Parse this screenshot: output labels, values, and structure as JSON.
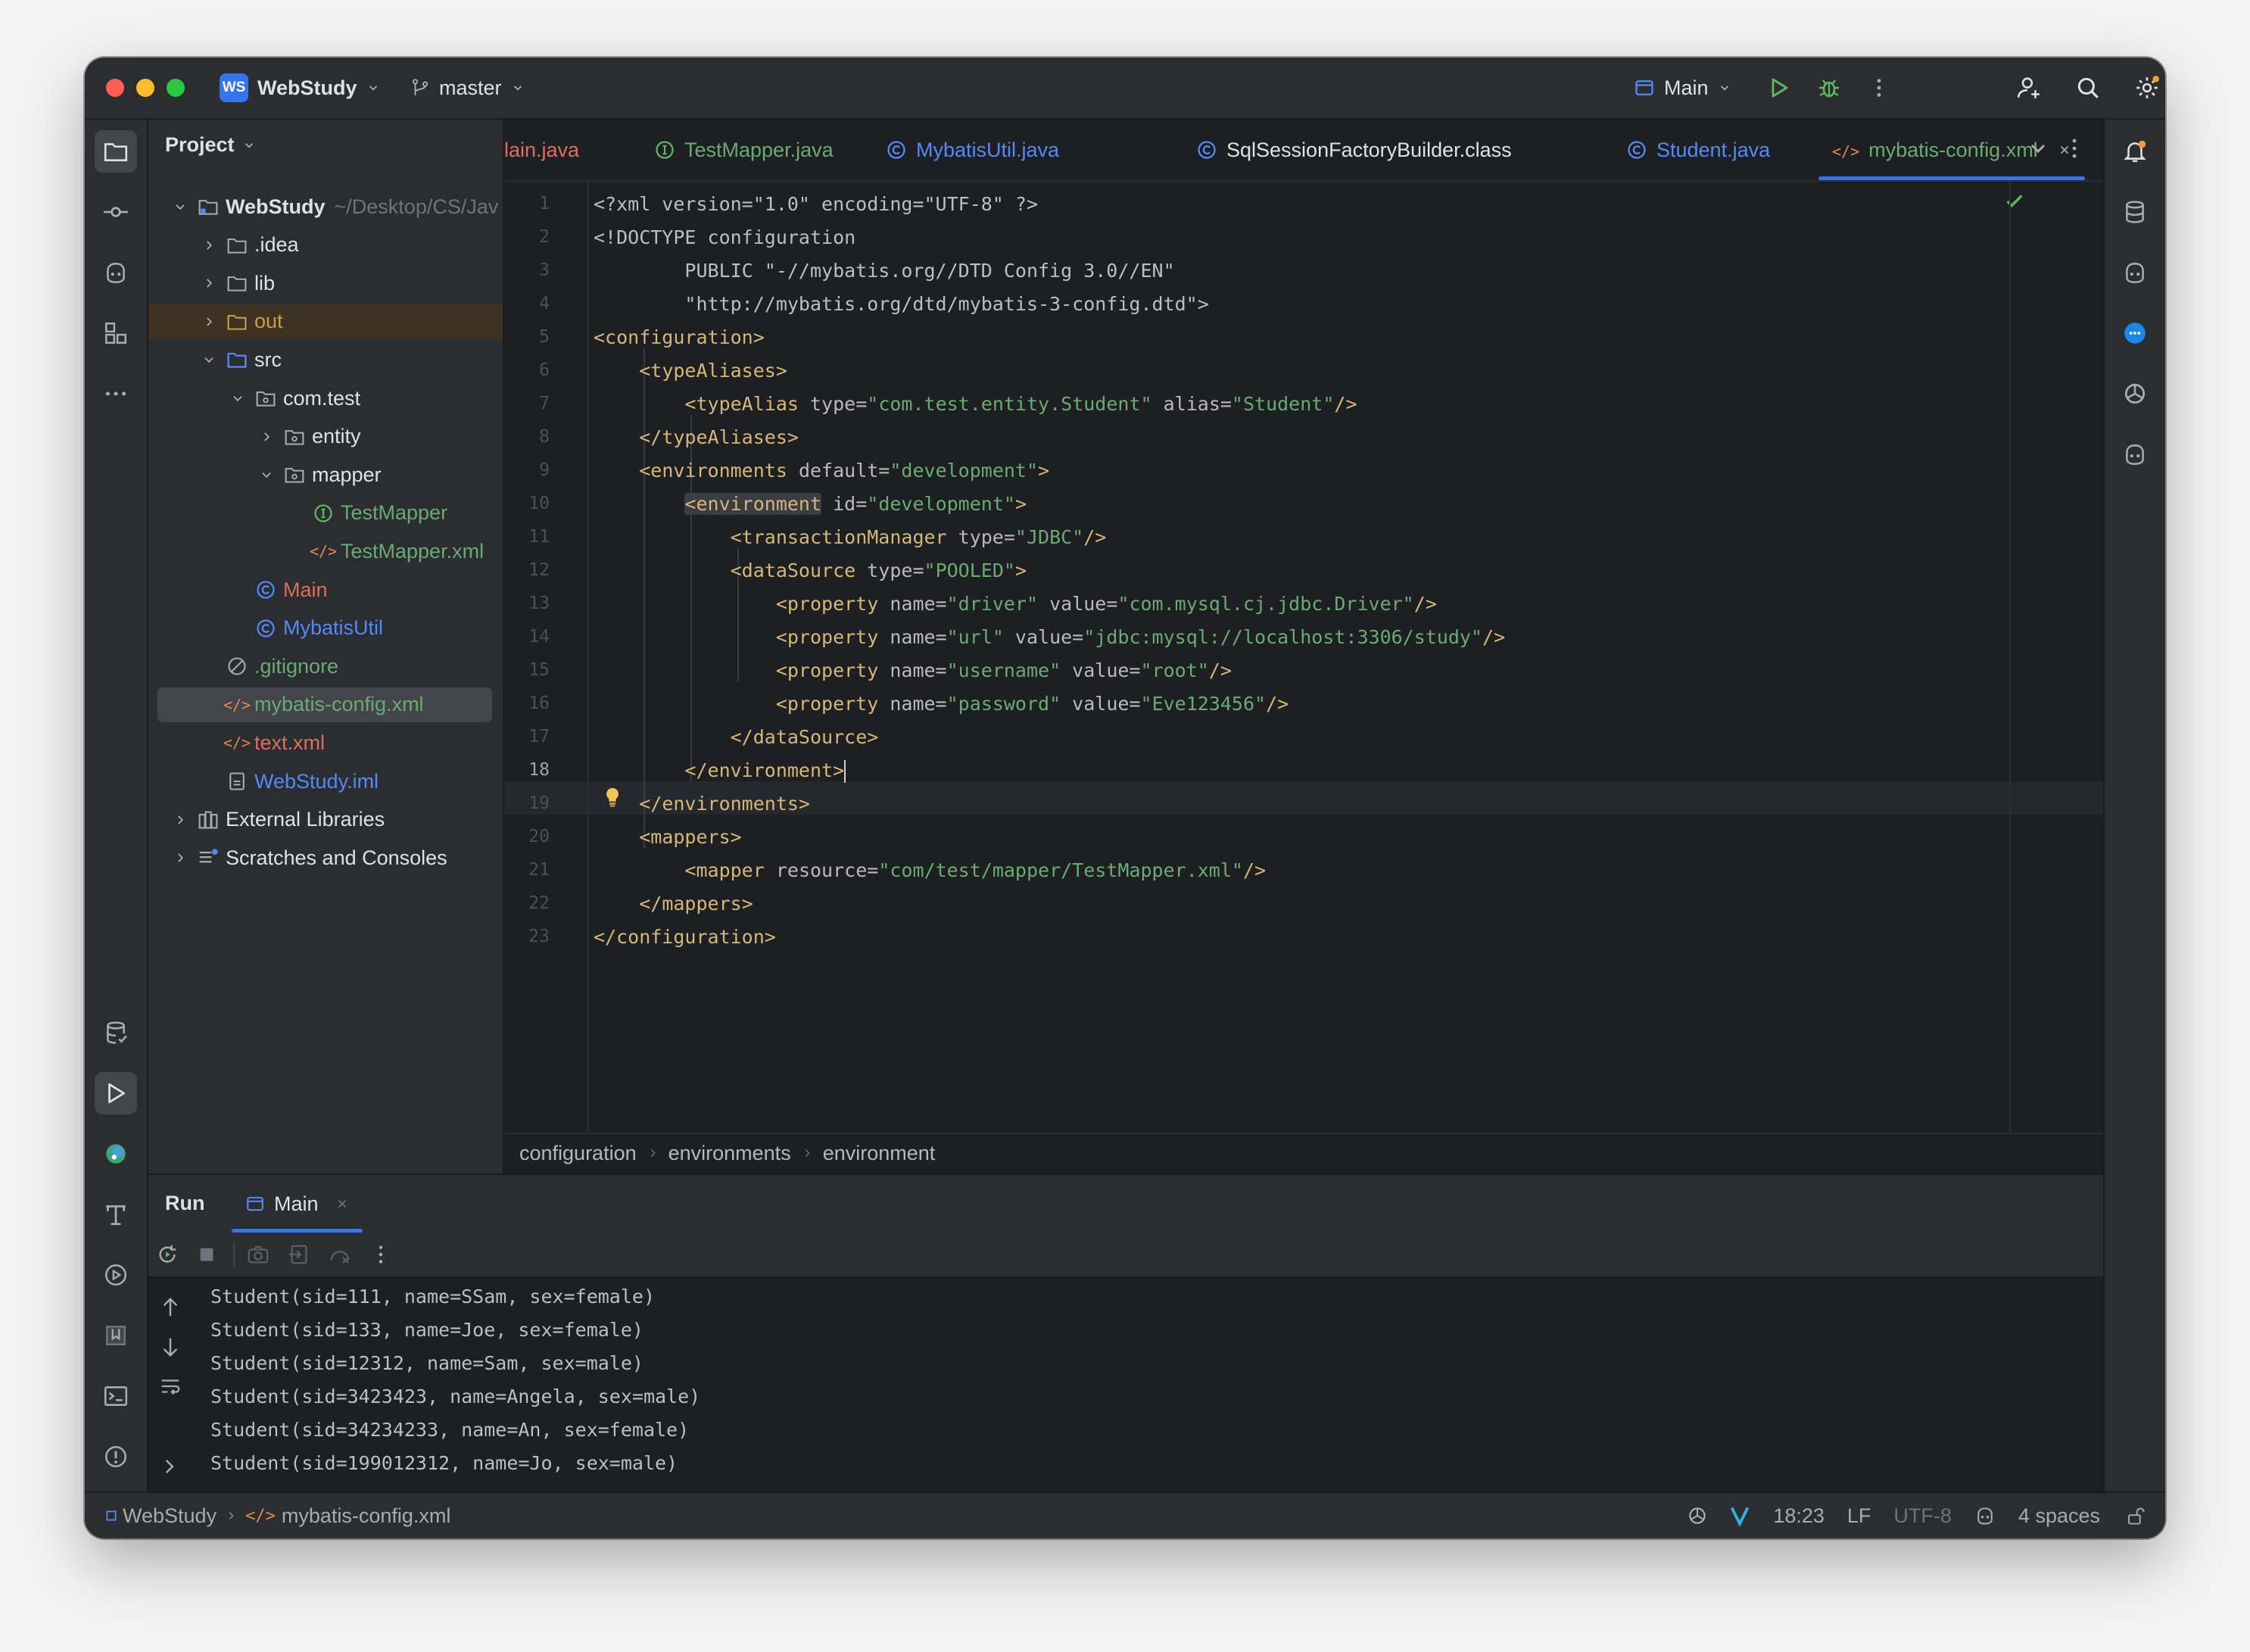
{
  "titlebar": {
    "project_badge": "WS",
    "project_name": "WebStudy",
    "branch": "master",
    "run_config": "Main"
  },
  "project_panel": {
    "title": "Project",
    "tree": [
      {
        "label": "WebStudy",
        "suffix": "~/Desktop/CS/Jav",
        "depth": 0,
        "chevron": "down",
        "icon": "module-folder-icon",
        "color": "#dfe1e5",
        "bold": true
      },
      {
        "label": ".idea",
        "depth": 1,
        "chevron": "right",
        "icon": "folder-icon",
        "color": "#dfe1e5"
      },
      {
        "label": "lib",
        "depth": 1,
        "chevron": "right",
        "icon": "folder-icon",
        "color": "#dfe1e5"
      },
      {
        "label": "out",
        "depth": 1,
        "chevron": "right",
        "icon": "excluded-folder-icon",
        "color": "#d19a45",
        "rowstyle": "out"
      },
      {
        "label": "src",
        "depth": 1,
        "chevron": "down",
        "icon": "source-folder-icon",
        "color": "#dfe1e5"
      },
      {
        "label": "com.test",
        "depth": 2,
        "chevron": "down",
        "icon": "package-icon",
        "color": "#dfe1e5"
      },
      {
        "label": "entity",
        "depth": 3,
        "chevron": "right",
        "icon": "package-icon",
        "color": "#dfe1e5"
      },
      {
        "label": "mapper",
        "depth": 3,
        "chevron": "down",
        "icon": "package-icon",
        "color": "#dfe1e5"
      },
      {
        "label": "TestMapper",
        "depth": 4,
        "chevron": "none",
        "icon": "interface-icon",
        "color": "#6aab73"
      },
      {
        "label": "TestMapper.xml",
        "depth": 4,
        "chevron": "none",
        "icon": "xml-file-icon",
        "color": "#6aab73"
      },
      {
        "label": "Main",
        "depth": 2,
        "chevron": "none",
        "icon": "class-icon",
        "color": "#e06c60"
      },
      {
        "label": "MybatisUtil",
        "depth": 2,
        "chevron": "none",
        "icon": "class-icon",
        "color": "#548af7"
      },
      {
        "label": ".gitignore",
        "depth": 1,
        "chevron": "none",
        "icon": "ignore-file-icon",
        "color": "#6aab73"
      },
      {
        "label": "mybatis-config.xml",
        "depth": 1,
        "chevron": "none",
        "icon": "xml-file-icon",
        "color": "#6aab73",
        "rowstyle": "selected"
      },
      {
        "label": "text.xml",
        "depth": 1,
        "chevron": "none",
        "icon": "xml-file-icon",
        "color": "#e06c60"
      },
      {
        "label": "WebStudy.iml",
        "depth": 1,
        "chevron": "none",
        "icon": "iml-file-icon",
        "color": "#548af7"
      },
      {
        "label": "External Libraries",
        "depth": 0,
        "chevron": "right",
        "icon": "libraries-icon",
        "color": "#dfe1e5"
      },
      {
        "label": "Scratches and Consoles",
        "depth": 0,
        "chevron": "right",
        "icon": "scratches-icon",
        "color": "#dfe1e5"
      }
    ]
  },
  "tabs": [
    {
      "label": "Main.java",
      "icon": "none",
      "color": "#e06c60",
      "partial_text": "lain.java"
    },
    {
      "label": "TestMapper.java",
      "icon": "interface-icon",
      "color": "#6aab73"
    },
    {
      "label": "MybatisUtil.java",
      "icon": "class-icon",
      "color": "#548af7"
    },
    {
      "label": "SqlSessionFactoryBuilder.class",
      "icon": "class-icon",
      "color": "#dfe1e5"
    },
    {
      "label": "Student.java",
      "icon": "class-icon",
      "color": "#548af7"
    },
    {
      "label": "mybatis-config.xml",
      "icon": "xml-file-icon",
      "color": "#6aab73",
      "active": true
    }
  ],
  "editor": {
    "current_line": 18,
    "lines": [
      [
        [
          "<?xml version=\"1.0\" encoding=\"UTF-8\" ?>",
          "p"
        ]
      ],
      [
        [
          "<!DOCTYPE configuration",
          "p"
        ]
      ],
      [
        [
          "        PUBLIC \"-//mybatis.org//DTD Config 3.0//EN\"",
          "p"
        ]
      ],
      [
        [
          "        \"http://mybatis.org/dtd/mybatis-3-config.dtd\">",
          "p"
        ]
      ],
      [
        [
          "<configuration>",
          "t"
        ]
      ],
      [
        [
          "    ",
          "p"
        ],
        [
          "<typeAliases>",
          "t"
        ]
      ],
      [
        [
          "        ",
          "p"
        ],
        [
          "<typeAlias ",
          "t"
        ],
        [
          "type=",
          "a"
        ],
        [
          "\"com.test.entity.Student\"",
          "s"
        ],
        [
          " alias=",
          "a"
        ],
        [
          "\"Student\"",
          "s"
        ],
        [
          "/>",
          "t"
        ]
      ],
      [
        [
          "    ",
          "p"
        ],
        [
          "</typeAliases>",
          "t"
        ]
      ],
      [
        [
          "    ",
          "p"
        ],
        [
          "<environments ",
          "t"
        ],
        [
          "default=",
          "a"
        ],
        [
          "\"development\"",
          "s"
        ],
        [
          ">",
          "t"
        ]
      ],
      [
        [
          "        ",
          "p"
        ],
        [
          "<environment",
          "t"
        ],
        [
          " id=",
          "a"
        ],
        [
          "\"development\"",
          "s"
        ],
        [
          ">",
          "t"
        ]
      ],
      [
        [
          "            ",
          "p"
        ],
        [
          "<transactionManager ",
          "t"
        ],
        [
          "type=",
          "a"
        ],
        [
          "\"JDBC\"",
          "s"
        ],
        [
          "/>",
          "t"
        ]
      ],
      [
        [
          "            ",
          "p"
        ],
        [
          "<dataSource ",
          "t"
        ],
        [
          "type=",
          "a"
        ],
        [
          "\"POOLED\"",
          "s"
        ],
        [
          ">",
          "t"
        ]
      ],
      [
        [
          "                ",
          "p"
        ],
        [
          "<property ",
          "t"
        ],
        [
          "name=",
          "a"
        ],
        [
          "\"driver\"",
          "s"
        ],
        [
          " value=",
          "a"
        ],
        [
          "\"com.mysql.cj.jdbc.Driver\"",
          "s"
        ],
        [
          "/>",
          "t"
        ]
      ],
      [
        [
          "                ",
          "p"
        ],
        [
          "<property ",
          "t"
        ],
        [
          "name=",
          "a"
        ],
        [
          "\"url\"",
          "s"
        ],
        [
          " value=",
          "a"
        ],
        [
          "\"jdbc:mysql://localhost:3306/study\"",
          "s"
        ],
        [
          "/>",
          "t"
        ]
      ],
      [
        [
          "                ",
          "p"
        ],
        [
          "<property ",
          "t"
        ],
        [
          "name=",
          "a"
        ],
        [
          "\"username\"",
          "s"
        ],
        [
          " value=",
          "a"
        ],
        [
          "\"root\"",
          "s"
        ],
        [
          "/>",
          "t"
        ]
      ],
      [
        [
          "                ",
          "p"
        ],
        [
          "<property ",
          "t"
        ],
        [
          "name=",
          "a"
        ],
        [
          "\"password\"",
          "s"
        ],
        [
          " value=",
          "a"
        ],
        [
          "\"Eve123456\"",
          "s"
        ],
        [
          "/>",
          "t"
        ]
      ],
      [
        [
          "            ",
          "p"
        ],
        [
          "</dataSource>",
          "t"
        ]
      ],
      [
        [
          "        ",
          "p"
        ],
        [
          "</environment>",
          "t"
        ]
      ],
      [
        [
          "    ",
          "p"
        ],
        [
          "</environments>",
          "t"
        ]
      ],
      [
        [
          "    ",
          "p"
        ],
        [
          "<mappers>",
          "t"
        ]
      ],
      [
        [
          "        ",
          "p"
        ],
        [
          "<mapper ",
          "t"
        ],
        [
          "resource=",
          "a"
        ],
        [
          "\"com/test/mapper/TestMapper.xml\"",
          "s"
        ],
        [
          "/>",
          "t"
        ]
      ],
      [
        [
          "    ",
          "p"
        ],
        [
          "</mappers>",
          "t"
        ]
      ],
      [
        [
          "</configuration>",
          "t"
        ]
      ]
    ]
  },
  "breadcrumbs": [
    "configuration",
    "environments",
    "environment"
  ],
  "run_panel": {
    "title": "Run",
    "tab": "Main",
    "output": [
      "Student(sid=111, name=SSam, sex=female)",
      "Student(sid=133, name=Joe, sex=female)",
      "Student(sid=12312, name=Sam, sex=male)",
      "Student(sid=3423423, name=Angela, sex=male)",
      "Student(sid=34234233, name=An, sex=female)",
      "Student(sid=199012312, name=Jo, sex=male)"
    ]
  },
  "statusbar": {
    "project": "WebStudy",
    "file": "mybatis-config.xml",
    "position": "18:23",
    "line_separator": "LF",
    "encoding": "UTF-8",
    "indent": "4 spaces"
  },
  "colors": {
    "accent": "#3574f0",
    "tag": "#d5b778",
    "string": "#6aab73",
    "attribute": "#bababa"
  }
}
